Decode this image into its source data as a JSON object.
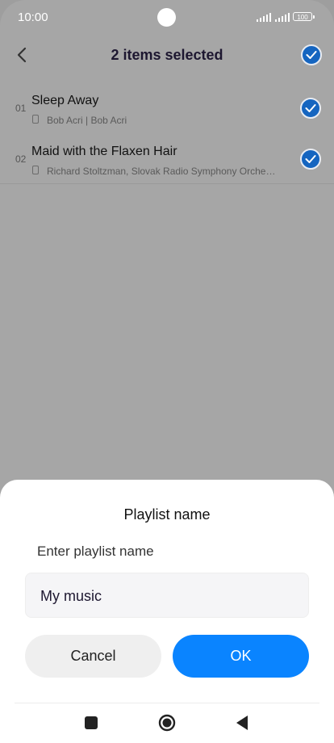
{
  "status_bar": {
    "time": "10:00",
    "battery": "100"
  },
  "header": {
    "title": "2 items selected"
  },
  "songs": [
    {
      "number": "01",
      "title": "Sleep Away",
      "artist": "Bob Acri | Bob Acri"
    },
    {
      "number": "02",
      "title": "Maid with the Flaxen Hair",
      "artist": "Richard Stoltzman, Slovak Radio Symphony Orche…"
    }
  ],
  "dialog": {
    "title": "Playlist name",
    "label": "Enter playlist name",
    "input_value": "My music",
    "cancel_label": "Cancel",
    "ok_label": "OK"
  },
  "colors": {
    "accent": "#0a84ff",
    "check": "#1565c0",
    "overlay": "#a6a6a6"
  }
}
